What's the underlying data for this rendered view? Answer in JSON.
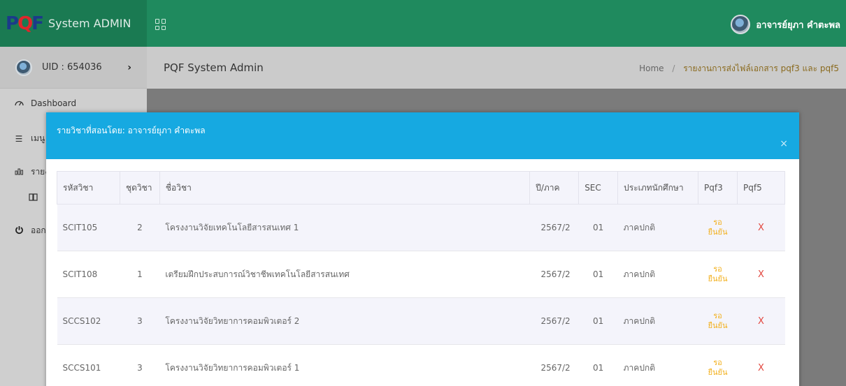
{
  "app": {
    "brand_text": "System ADMIN",
    "user_name": "อาจารย์ยุภา คำตะพล"
  },
  "sidebar": {
    "uid": "UID : 654036",
    "items": [
      {
        "label": "Dashboard",
        "icon": "dashboard-icon"
      },
      {
        "label": "เมนู",
        "icon": "list-icon"
      },
      {
        "label": "รายงาน",
        "icon": "chart-icon"
      },
      {
        "label": "",
        "icon": "book-icon"
      },
      {
        "label": "ออก",
        "icon": "power-icon"
      }
    ]
  },
  "header": {
    "page_title": "PQF System Admin",
    "breadcrumb_home": "Home",
    "breadcrumb_sep": "/",
    "breadcrumb_current": "รายงานการส่งไฟล์เอกสาร pqf3 และ pqf5"
  },
  "modal": {
    "title": "รายวิชาที่สอนโดย: อาจารย์ยุภา คำตะพล",
    "close": "×",
    "columns": [
      "รหัสวิชา",
      "ชุดวิชา",
      "ชื่อวิชา",
      "ปี/ภาค",
      "SEC",
      "ประเภทนักศึกษา",
      "Pqf3",
      "Pqf5"
    ],
    "rows": [
      {
        "code": "SCIT105",
        "set": "2",
        "name": "โครงงานวิจัยเทคโนโลยีสารสนเทศ 1",
        "term": "2567/2",
        "sec": "01",
        "type": "ภาคปกติ",
        "pqf3_line1": "รอ",
        "pqf3_line2": "ยืนยัน",
        "pqf5": "X"
      },
      {
        "code": "SCIT108",
        "set": "1",
        "name": "เตรียมฝึกประสบการณ์วิชาชีพเทคโนโลยีสารสนเทศ",
        "term": "2567/2",
        "sec": "01",
        "type": "ภาคปกติ",
        "pqf3_line1": "รอ",
        "pqf3_line2": "ยืนยัน",
        "pqf5": "X"
      },
      {
        "code": "SCCS102",
        "set": "3",
        "name": "โครงงานวิจัยวิทยาการคอมพิวเตอร์ 2",
        "term": "2567/2",
        "sec": "01",
        "type": "ภาคปกติ",
        "pqf3_line1": "รอ",
        "pqf3_line2": "ยืนยัน",
        "pqf5": "X"
      },
      {
        "code": "SCCS101",
        "set": "3",
        "name": "โครงงานวิจัยวิทยาการคอมพิวเตอร์ 1",
        "term": "2567/2",
        "sec": "01",
        "type": "ภาคปกติ",
        "pqf3_line1": "รอ",
        "pqf3_line2": "ยืนยัน",
        "pqf5": "X"
      }
    ]
  }
}
